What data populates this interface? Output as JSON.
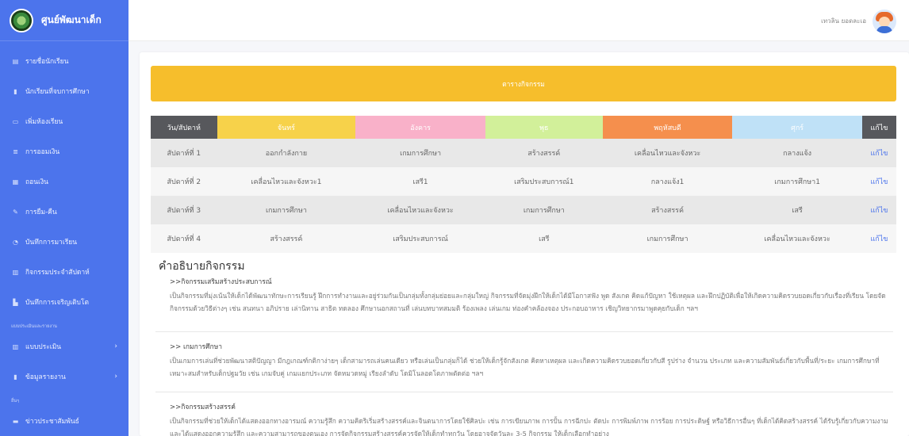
{
  "sidebar": {
    "brand": "ศูนย์พัฒนาเด็ก",
    "items": [
      {
        "label": "รายชื่อนักเรียน",
        "icon": "file-icon"
      },
      {
        "label": "นักเรียนที่จบการศึกษา",
        "icon": "file-icon"
      },
      {
        "label": "เพิ่มห้องเรียน",
        "icon": "chat-icon"
      },
      {
        "label": "การออมเงิน",
        "icon": "list-icon"
      },
      {
        "label": "ถอนเงิน",
        "icon": "grid-icon"
      },
      {
        "label": "การยืม-คืน",
        "icon": "pencil-icon"
      },
      {
        "label": "บันทึกการมาเรียน",
        "icon": "users-icon"
      },
      {
        "label": "กิจกรรมประจำสัปดาห์",
        "icon": "table-icon"
      },
      {
        "label": "บันทึกการเจริญเติบโต",
        "icon": "chart-icon"
      }
    ],
    "section1": "แบบประเมินและรายงาน",
    "items2": [
      {
        "label": "แบบประเมิน",
        "icon": "table-icon"
      },
      {
        "label": "ข้อมูลรายงาน",
        "icon": "file-icon"
      }
    ],
    "section2": "อื่นๆ",
    "items3": [
      {
        "label": "ข่าวประชาสัมพันธ์",
        "icon": "card-icon"
      }
    ]
  },
  "topbar": {
    "user": "เทวลิน ยอดละเอ"
  },
  "banner": "ตารางกิจกรรม",
  "schedule": {
    "headers": [
      "วัน/สัปดาห์",
      "จันทร์",
      "อังคาร",
      "พุธ",
      "พฤหัสบดี",
      "ศุกร์",
      "แก้ไข"
    ],
    "rows": [
      [
        "สัปดาห์ที่ 1",
        "ออกกำลังกาย",
        "เกมการศึกษา",
        "สร้างสรรค์",
        "เคลื่อนไหวและจังหวะ",
        "กลางแจ้ง",
        "แก้ไข"
      ],
      [
        "สัปดาห์ที่ 2",
        "เคลื่อนไหวและจังหวะ1",
        "เสรี1",
        "เสริมประสบการณ์1",
        "กลางแจ้ง1",
        "เกมการศึกษา1",
        "แก้ไข"
      ],
      [
        "สัปดาห์ที่ 3",
        "เกมการศึกษา",
        "เคลื่อนไหวและจังหวะ",
        "เกมการศึกษา",
        "สร้างสรรค์",
        "เสรี",
        "แก้ไข"
      ],
      [
        "สัปดาห์ที่ 4",
        "สร้างสรรค์",
        "เสริมประสบการณ์",
        "เสรี",
        "เกมการศึกษา",
        "เคลื่อนไหวและจังหวะ",
        "แก้ไข"
      ]
    ]
  },
  "description": {
    "title": "คำอธิบายกิจกรรม",
    "items": [
      {
        "title": ">>กิจกรรมเสริมสร้างประสบการณ์",
        "body": "เป็นกิจกรรมที่มุ่งเน้นให้เด็กได้พัฒนาทักษะการเรียนรู้ ฝึกการทำงานและอยู่ร่วมกันเป็นกลุ่มทั้งกลุ่มย่อยและกลุ่มใหญ่ กิจกรรมที่จัดมุ่งฝึกให้เด็กได้มีโอกาสฟัง พูด สังเกต คิดแก้ปัญหา ใช้เหตุผล และฝึกปฏิบัติเพื่อให้เกิดความคิดรวบยอดเกี่ยวกับเรื่องที่เรียน โดยจัดกิจกรรมด้วยวิธีต่างๆ เช่น สนทนา อภิปราย เล่านิทาน สาธิต ทดลอง ศึกษานอกสถานที่ เล่นบทบาทสมมติ ร้องเพลง เล่นเกม ท่องคำคล้องจอง ประกอบอาหาร เชิญวิทยากรมาพูดคุยกับเด็ก ฯลฯ"
      },
      {
        "title": ">> เกมการศึกษา",
        "body": "เป็นเกมการเล่นที่ช่วยพัฒนาสติปัญญา มีกฎเกณฑ์กติกาง่ายๆ เด็กสามารถเล่นคนเดียว หรือเล่นเป็นกลุ่มก็ได้ ช่วยให้เด็กรู้จักสังเกต คิดหาเหตุผล และเกิดความคิดรวบยอดเกี่ยวกับสี รูปร่าง จำนวน ประเภท และความสัมพันธ์เกี่ยวกับพื้นที่/ระยะ เกมการศึกษาที่เหมาะสมสำหรับเด็กปฐมวัย เช่น เกมจับคู่ เกมแยกประเภท จัดหมวดหมู่ เรียงลำดับ โดมิโนลอตโตภาพตัดต่อ ฯลฯ"
      },
      {
        "title": ">>กิจกรรมสร้างสรรค์",
        "body": "เป็นกิจกรรมที่ช่วยให้เด็กได้แสดงออกทางอารมณ์ ความรู้สึก ความคิดริเริ่มสร้างสรรค์และจินตนาการโดยใช้ศิลปะ เช่น การเขียนภาพ การปั้น การฉีกปะ ตัดปะ การพิมพ์ภาพ การร้อย การประดิษฐ์ หรือวิธีการอื่นๆ ที่เด็กได้คิดสร้างสรรค์ ได้รับรู้เกี่ยวกับความงาม และได้แสดงออกความรู้สึก และความสามารถของตนเอง การจัดกิจกรรมสร้างสรรค์ควรจัดให้เด็กทำทุกวัน โดยอาจจัดวันละ 3-5 กิจกรรม ให้เด็กเลือกทำอย่าง"
      }
    ]
  }
}
